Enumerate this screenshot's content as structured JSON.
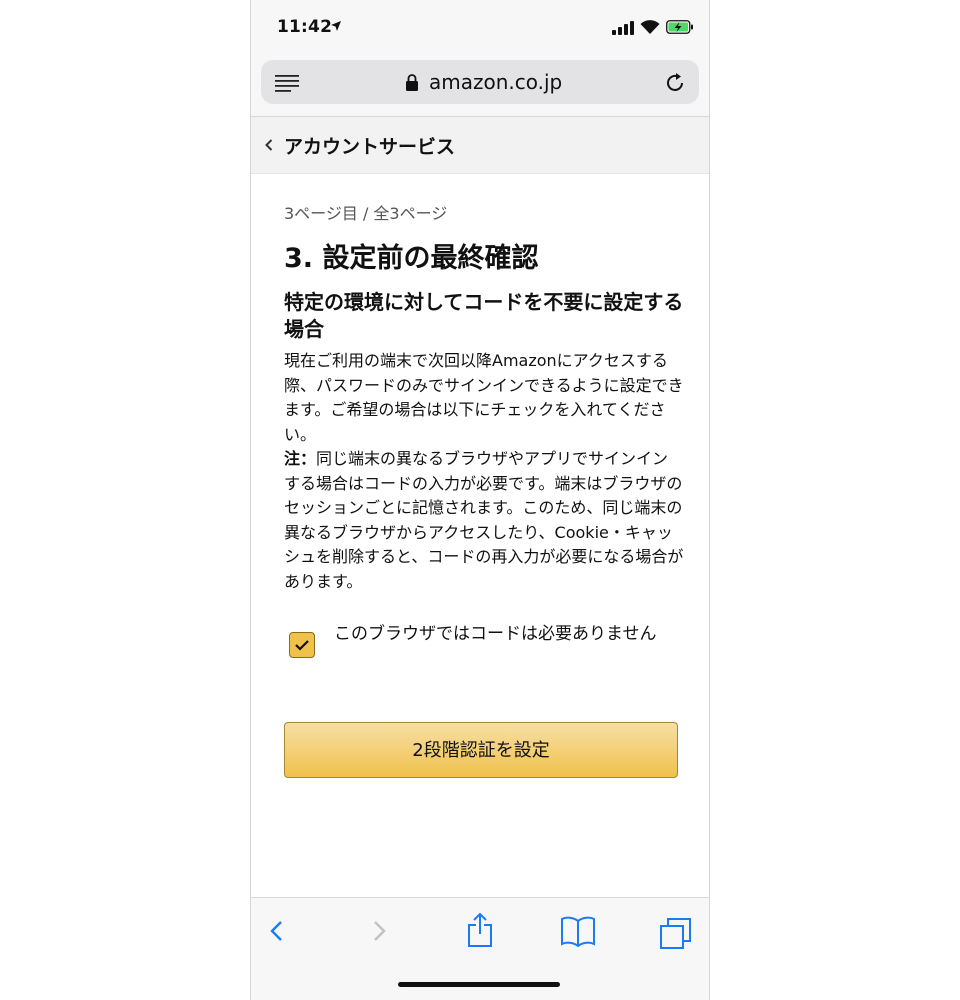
{
  "status_bar": {
    "time": "11:42"
  },
  "browser": {
    "url": "amazon.co.jp"
  },
  "nav": {
    "back_label": "アカウントサービス"
  },
  "content": {
    "page_indicator": "3ページ目 / 全3ページ",
    "step_title": "3. 設定前の最終確認",
    "section_heading": "特定の環境に対してコードを不要に設定する場合",
    "paragraph": "現在ご利用の端末で次回以降Amazonにアクセスする際、パスワードのみでサインインできるように設定できます。ご希望の場合は以下にチェックを入れてください。",
    "note_label": "注：",
    "note_text": "同じ端末の異なるブラウザやアプリでサインインする場合はコードの入力が必要です。端末はブラウザのセッションごとに記憶されます。このため、同じ端末の異なるブラウザからアクセスしたり、Cookie・キャッシュを削除すると、コードの再入力が必要になる場合があります。",
    "checkbox_label": "このブラウザではコードは必要ありません",
    "checkbox_checked": true,
    "submit_label": "2段階認証を設定"
  },
  "colors": {
    "button_fill": "#f0c14b",
    "checkbox_fill": "#f0c14b",
    "toolbar_icon_blue": "#1a7cf5"
  },
  "icons": {
    "reader": "reader-icon",
    "lock": "lock-icon",
    "reload": "reload-icon",
    "back": "chevron-left-icon",
    "browser_back": "back-arrow-icon",
    "browser_forward": "forward-arrow-icon",
    "share": "share-icon",
    "bookmarks": "bookmarks-icon",
    "tabs": "tabs-icon"
  }
}
